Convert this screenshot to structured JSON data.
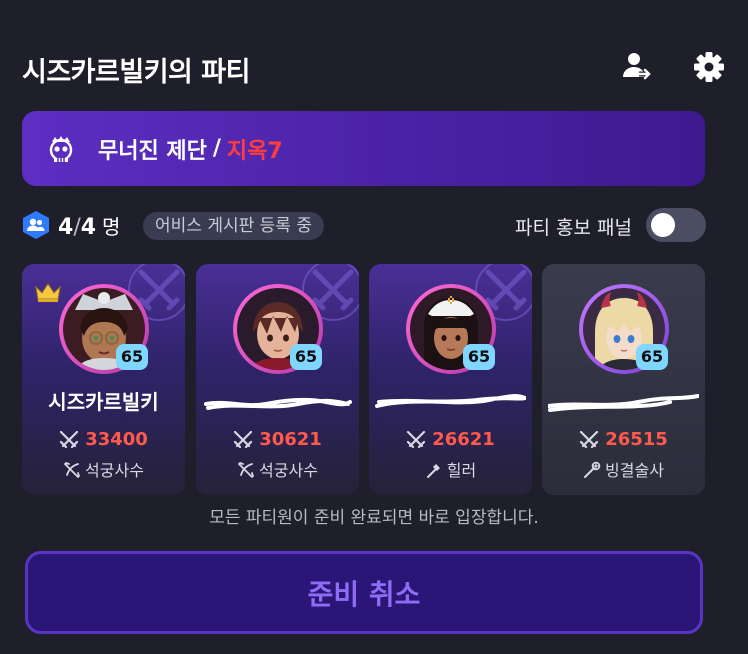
{
  "header": {
    "title": "시즈카르빌키의 파티"
  },
  "dungeon": {
    "name": "무너진 제단",
    "separator": "/",
    "difficulty": "지옥7"
  },
  "party": {
    "current": "4",
    "slash": "/",
    "max": "4",
    "unit": "명",
    "status_badge": "어비스 게시판 등록 중"
  },
  "promo": {
    "label": "파티 홍보 패널",
    "enabled": false
  },
  "members": [
    {
      "name": "시즈카르빌키",
      "level": "65",
      "power": "33400",
      "job": "석궁사수",
      "leader": true
    },
    {
      "name": "",
      "level": "65",
      "power": "30621",
      "job": "석궁사수",
      "leader": false
    },
    {
      "name": "",
      "level": "65",
      "power": "26621",
      "job": "힐러",
      "leader": false
    },
    {
      "name": "",
      "level": "65",
      "power": "26515",
      "job": "빙결술사",
      "leader": false
    }
  ],
  "notice": "모든 파티원이 준비 완료되면 바로 입장합니다.",
  "cancel_button": "준비 취소",
  "colors": {
    "accent_purple": "#5d2ec2",
    "power_red": "#ff5a4b",
    "difficulty_red": "#ff3d3d",
    "level_badge": "#7fd6ff"
  }
}
